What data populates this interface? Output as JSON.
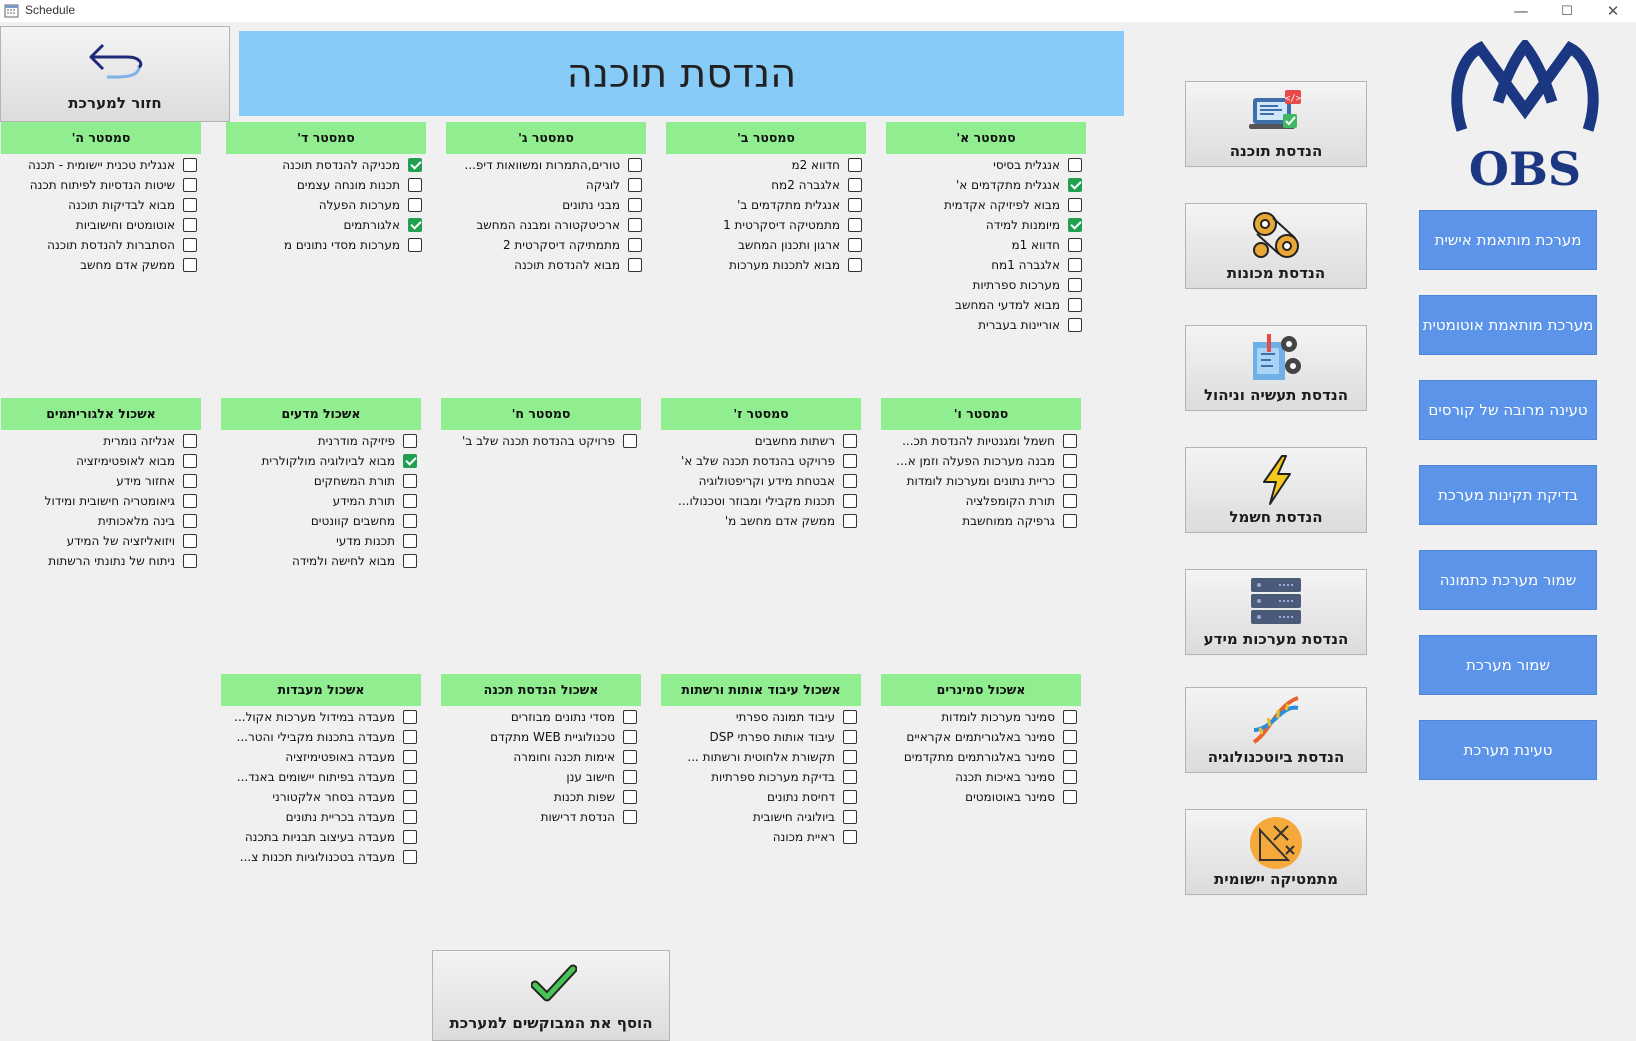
{
  "window": {
    "title": "Schedule",
    "minimize": "—",
    "maximize": "☐",
    "close": "✕"
  },
  "back_button": {
    "label": "חזור למערכת"
  },
  "banner": {
    "title": "הנדסת תוכנה"
  },
  "logo": {
    "text": "OBS"
  },
  "departments": [
    {
      "label": "הנדסת תוכנה",
      "icon": "software-icon"
    },
    {
      "label": "הנדסת מכונות",
      "icon": "gears-icon"
    },
    {
      "label": "הנדסת תעשיה וניהול",
      "icon": "blueprint-gear-icon"
    },
    {
      "label": "הנדסת חשמל",
      "icon": "lightning-icon"
    },
    {
      "label": "הנדסת מערכות מידע",
      "icon": "server-icon"
    },
    {
      "label": "הנדסת ביוטכנולוגיה",
      "icon": "dna-icon"
    },
    {
      "label": "מתמטיקה יישומית",
      "icon": "math-icon"
    }
  ],
  "side_buttons": [
    {
      "label": "מערכת מותאמת אישית"
    },
    {
      "label": "מערכת מותאמת אוטומטית"
    },
    {
      "label": "טעינה מרובה של קורסים"
    },
    {
      "label": "בדיקת תקינות מערכת"
    },
    {
      "label": "שמור מערכת כתמונה"
    },
    {
      "label": "שמור מערכת"
    },
    {
      "label": "טעינת מערכת"
    }
  ],
  "groups": [
    {
      "header": "סמסטר א'",
      "items": [
        {
          "label": "אנגלית בסיסי",
          "checked": false
        },
        {
          "label": "אנגלית מתקדמים א'",
          "checked": true
        },
        {
          "label": "מבוא לפיזיקה אקדמית",
          "checked": false
        },
        {
          "label": "מיומנות למידה",
          "checked": true
        },
        {
          "label": "חדווא 1מ",
          "checked": false
        },
        {
          "label": "אלגברה 1מח",
          "checked": false
        },
        {
          "label": "מערכות ספרתיות",
          "checked": false
        },
        {
          "label": "מבוא למדעי המחשב",
          "checked": false
        },
        {
          "label": "אוריינות בעברית",
          "checked": false
        }
      ]
    },
    {
      "header": "סמסטר ב'",
      "items": [
        {
          "label": "חדווא 2מ",
          "checked": false
        },
        {
          "label": "אלגברה 2מח",
          "checked": false
        },
        {
          "label": "אנגלית מתקדמים ב'",
          "checked": false
        },
        {
          "label": "מתמטיקה דיסקרטית 1",
          "checked": false
        },
        {
          "label": "ארגון ותכנון המחשב",
          "checked": false
        },
        {
          "label": "מבוא לתכנות מערכות",
          "checked": false
        }
      ]
    },
    {
      "header": "סמסטר ג'",
      "items": [
        {
          "label": "טורים,התמרות ומשוואות דיפ...",
          "checked": false
        },
        {
          "label": "לוגיקה",
          "checked": false
        },
        {
          "label": "מבני נתונים",
          "checked": false
        },
        {
          "label": "ארכיטקטורה ומבנה המחשב",
          "checked": false
        },
        {
          "label": "מתמתיקה דיסקרטית 2",
          "checked": false
        },
        {
          "label": "מבוא להנדסת תוכנה",
          "checked": false
        }
      ]
    },
    {
      "header": "סמסטר ד'",
      "items": [
        {
          "label": "מכניקה להנדסת תוכנה",
          "checked": true
        },
        {
          "label": "תכנות מונחה עצמים",
          "checked": false
        },
        {
          "label": "מערכות הפעלה",
          "checked": false
        },
        {
          "label": "אלגורתמים",
          "checked": true
        },
        {
          "label": "מערכות מסדי נתונים מ",
          "checked": false
        }
      ]
    },
    {
      "header": "סמסטר ה'",
      "items": [
        {
          "label": "אנגלית טכנית יישומית - תכנה",
          "checked": false
        },
        {
          "label": "שיטות הנדסיות לפיתוח תכנה",
          "checked": false
        },
        {
          "label": "מבוא לבדיקות תוכנה",
          "checked": false
        },
        {
          "label": "אוטומטים וחישוביות",
          "checked": false
        },
        {
          "label": "הסתברות להנדסת תוכנה",
          "checked": false
        },
        {
          "label": "ממשק אדם מחשב",
          "checked": false
        }
      ]
    },
    {
      "header": "סמסטר ו'",
      "items": [
        {
          "label": "חשמל ומגנטיות להנדסת תכ...",
          "checked": false
        },
        {
          "label": "מבנה מערכות הפעלה וזמן א...",
          "checked": false
        },
        {
          "label": "כריית נתונים ומערכות לומדות",
          "checked": false
        },
        {
          "label": "תורת הקומפלציה",
          "checked": false
        },
        {
          "label": "גרפיקה ממוחשבת",
          "checked": false
        }
      ]
    },
    {
      "header": "סמסטר ז'",
      "items": [
        {
          "label": "רשתות מחשבים",
          "checked": false
        },
        {
          "label": "פרויקט בהנדסת תכנה שלב א'",
          "checked": false
        },
        {
          "label": "אבטחת מידע וקריפטולוגיה",
          "checked": false
        },
        {
          "label": "תכנות מקבילי ומבוזר וטכנולו...",
          "checked": false
        },
        {
          "label": "ממשק אדם מחשב מ'",
          "checked": false
        }
      ]
    },
    {
      "header": "סמסטר ח'",
      "items": [
        {
          "label": "פרויקט בהנדסת תכנה שלב ב'",
          "checked": false
        }
      ]
    },
    {
      "header": "אשכול מדעים",
      "items": [
        {
          "label": "פיזיקה מודרנית",
          "checked": false
        },
        {
          "label": "מבוא לביולוגיה מולקולרית",
          "checked": true
        },
        {
          "label": "תורת המשחקים",
          "checked": false
        },
        {
          "label": "תורת המידע",
          "checked": false
        },
        {
          "label": "מחשבים קוונטים",
          "checked": false
        },
        {
          "label": "תכנות מדעי",
          "checked": false
        },
        {
          "label": "מבוא לחישה ולמידה",
          "checked": false
        }
      ]
    },
    {
      "header": "אשכול אלגוריתמים",
      "items": [
        {
          "label": "אנליזה נומרית",
          "checked": false
        },
        {
          "label": "מבוא לאופטימיזציה",
          "checked": false
        },
        {
          "label": "אחזור מידע",
          "checked": false
        },
        {
          "label": "גיאומטריה חישובית ומידול",
          "checked": false
        },
        {
          "label": "בינה מלאכותית",
          "checked": false
        },
        {
          "label": "ויזואליזציה של המידע",
          "checked": false
        },
        {
          "label": "ניתוח של נתונתי הרשתות",
          "checked": false
        }
      ]
    },
    {
      "header": "אשכול סמינרים",
      "items": [
        {
          "label": "סמינר מערכות לומדות",
          "checked": false
        },
        {
          "label": "סמינר באלגוריתמים אקראיים",
          "checked": false
        },
        {
          "label": "סמינר באלגורתמים מתקדמים",
          "checked": false
        },
        {
          "label": "סמינר באיכות תכנה",
          "checked": false
        },
        {
          "label": "סמינר באוטומטים",
          "checked": false
        }
      ]
    },
    {
      "header": "אשכול עיבוד אותות ורשתות",
      "items": [
        {
          "label": "עיבוד תמונה ספרתי",
          "checked": false
        },
        {
          "label": "עיבוד אותות ספרתי DSP",
          "checked": false
        },
        {
          "label": "תקשורת אלחוטית ורשתות ...",
          "checked": false
        },
        {
          "label": "בדיקת מערכות ספרתיות",
          "checked": false
        },
        {
          "label": "דחיסת נתונים",
          "checked": false
        },
        {
          "label": "ביולוגיה חישובית",
          "checked": false
        },
        {
          "label": "ראיית מכונה",
          "checked": false
        }
      ]
    },
    {
      "header": "אשכול הנדסת תכנה",
      "items": [
        {
          "label": "מסדי נתונים מבוזרים",
          "checked": false
        },
        {
          "label": "טכנולוגיית WEB מתקדם",
          "checked": false
        },
        {
          "label": "אימות תכנה וחומרה",
          "checked": false
        },
        {
          "label": "חישוב ענן",
          "checked": false
        },
        {
          "label": "שפות תכנות",
          "checked": false
        },
        {
          "label": "הנדסת דרישות",
          "checked": false
        }
      ]
    },
    {
      "header": "אשכול מעבדות",
      "items": [
        {
          "label": "מעבדה במידול מערכות אקול...",
          "checked": false
        },
        {
          "label": "מעבדה בתכנות מקבילי והטר...",
          "checked": false
        },
        {
          "label": "מעבדה באופטימיזציה",
          "checked": false
        },
        {
          "label": "מעבדה בפיתוח יישומים באנד...",
          "checked": false
        },
        {
          "label": "מעבדה בסחר אלקטורני",
          "checked": false
        },
        {
          "label": "מעבדה בכריית נתונים",
          "checked": false
        },
        {
          "label": "מעבדה בעיצוב תבניות בתכנה",
          "checked": false
        },
        {
          "label": "מעבדה בטכנולוגיות תכנות צ...",
          "checked": false
        }
      ]
    }
  ],
  "add_button": {
    "label": "הוסף את המבוקשים למערכת"
  }
}
